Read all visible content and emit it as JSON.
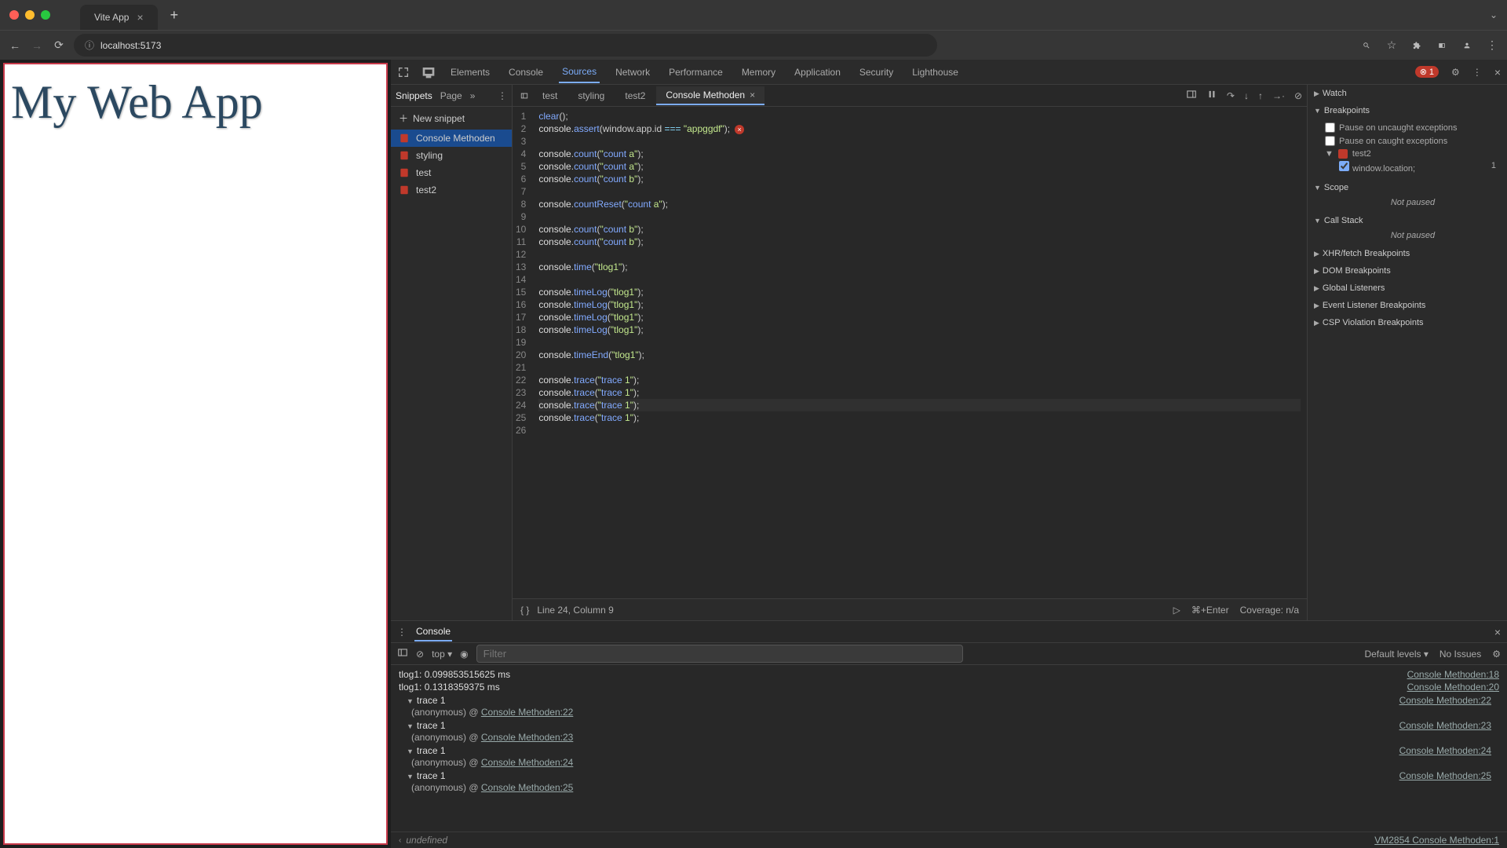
{
  "browser": {
    "tab_title": "Vite App",
    "url": "localhost:5173"
  },
  "page": {
    "heading": "My Web App"
  },
  "devtools": {
    "tabs": [
      "Elements",
      "Console",
      "Sources",
      "Network",
      "Performance",
      "Memory",
      "Application",
      "Security",
      "Lighthouse"
    ],
    "active_tab": "Sources",
    "error_count": "1"
  },
  "snippets": {
    "left_tabs": {
      "snippets": "Snippets",
      "page": "Page"
    },
    "new_snippet": "New snippet",
    "items": [
      "Console Methoden",
      "styling",
      "test",
      "test2"
    ],
    "active": "Console Methoden"
  },
  "editor": {
    "tabs": [
      "test",
      "styling",
      "test2",
      "Console Methoden"
    ],
    "active": "Console Methoden",
    "code_lines": [
      "clear();",
      "console.assert(window.app.id === \"appggdf\");",
      "",
      "console.count(\"count a\");",
      "console.count(\"count a\");",
      "console.count(\"count b\");",
      "",
      "console.countReset(\"count a\");",
      "",
      "console.count(\"count b\");",
      "console.count(\"count b\");",
      "",
      "console.time(\"tlog1\");",
      "",
      "console.timeLog(\"tlog1\");",
      "console.timeLog(\"tlog1\");",
      "console.timeLog(\"tlog1\");",
      "console.timeLog(\"tlog1\");",
      "",
      "console.timeEnd(\"tlog1\");",
      "",
      "console.trace(\"trace 1\");",
      "console.trace(\"trace 1\");",
      "console.trace(\"trace 1\");",
      "console.trace(\"trace 1\");",
      ""
    ],
    "highlighted_line": 24,
    "status": {
      "position": "Line 24, Column 9",
      "run_hint": "⌘+Enter",
      "coverage": "Coverage: n/a"
    }
  },
  "debugger": {
    "sections": {
      "watch": "Watch",
      "breakpoints": "Breakpoints",
      "pause_uncaught": "Pause on uncaught exceptions",
      "pause_caught": "Pause on caught exceptions",
      "bp_file": "test2",
      "bp_line_code": "window.location;",
      "bp_line_num": "1",
      "scope": "Scope",
      "not_paused": "Not paused",
      "callstack": "Call Stack",
      "xhr": "XHR/fetch Breakpoints",
      "dom": "DOM Breakpoints",
      "global": "Global Listeners",
      "event": "Event Listener Breakpoints",
      "csp": "CSP Violation Breakpoints"
    }
  },
  "console": {
    "drawer_tab": "Console",
    "context": "top",
    "filter_placeholder": "Filter",
    "levels": "Default levels",
    "issues": "No Issues",
    "logs": [
      {
        "text": "tlog1: 0.099853515625 ms",
        "src": "Console Methoden:18"
      },
      {
        "text": "tlog1: 0.1318359375 ms",
        "src": "Console Methoden:20"
      }
    ],
    "traces": [
      {
        "label": "trace 1",
        "anon": "(anonymous)",
        "at": "@",
        "link": "Console Methoden:22",
        "src": "Console Methoden:22"
      },
      {
        "label": "trace 1",
        "anon": "(anonymous)",
        "at": "@",
        "link": "Console Methoden:23",
        "src": "Console Methoden:23"
      },
      {
        "label": "trace 1",
        "anon": "(anonymous)",
        "at": "@",
        "link": "Console Methoden:24",
        "src": "Console Methoden:24"
      },
      {
        "label": "trace 1",
        "anon": "(anonymous)",
        "at": "@",
        "link": "Console Methoden:25",
        "src": "Console Methoden:25"
      }
    ],
    "return_undefined": "undefined",
    "return_src": "VM2854 Console Methoden:1"
  }
}
